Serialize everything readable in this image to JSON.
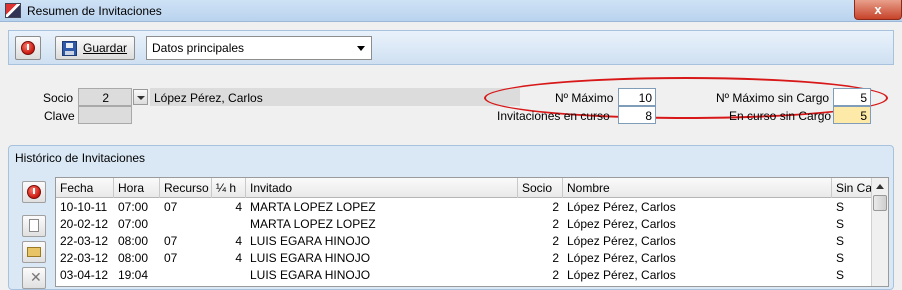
{
  "window": {
    "title": "Resumen de Invitaciones",
    "close": "x"
  },
  "toolbar": {
    "save_label": "Guardar",
    "view_select": "Datos principales"
  },
  "form": {
    "socio_label": "Socio",
    "socio_num": "2",
    "socio_name": "López Pérez, Carlos",
    "clave_label": "Clave",
    "clave_value": "",
    "max_label": "Nº Máximo",
    "max_value": "10",
    "max_sin_cargo_label": "Nº Máximo sin Cargo",
    "max_sin_cargo_value": "5",
    "en_curso_label": "Invitaciones en curso",
    "en_curso_value": "8",
    "en_curso_sin_cargo_label": "En curso sin Cargo",
    "en_curso_sin_cargo_value": "5"
  },
  "history": {
    "title": "Histórico de Invitaciones",
    "columns": [
      "Fecha",
      "Hora",
      "Recurso",
      "¼ h",
      "Invitado",
      "Socio",
      "Nombre",
      "Sin Car"
    ],
    "rows": [
      [
        "10-10-11",
        "07:00",
        "07",
        "4",
        "MARTA LOPEZ LOPEZ",
        "2",
        "López Pérez, Carlos",
        "S"
      ],
      [
        "20-02-12",
        "07:00",
        "",
        "",
        "MARTA LOPEZ LOPEZ",
        "2",
        "López Pérez, Carlos",
        "S"
      ],
      [
        "22-03-12",
        "08:00",
        "07",
        "4",
        "LUIS EGARA HINOJO",
        "2",
        "López Pérez, Carlos",
        "S"
      ],
      [
        "22-03-12",
        "08:00",
        "07",
        "4",
        "LUIS EGARA HINOJO",
        "2",
        "López Pérez, Carlos",
        "S"
      ],
      [
        "03-04-12",
        "19:04",
        "",
        "",
        "LUIS EGARA HINOJO",
        "2",
        "López Pérez, Carlos",
        "S"
      ]
    ]
  },
  "colors": {
    "highlight_ellipse": "#d81818",
    "yellow_field": "#fde9a8"
  }
}
